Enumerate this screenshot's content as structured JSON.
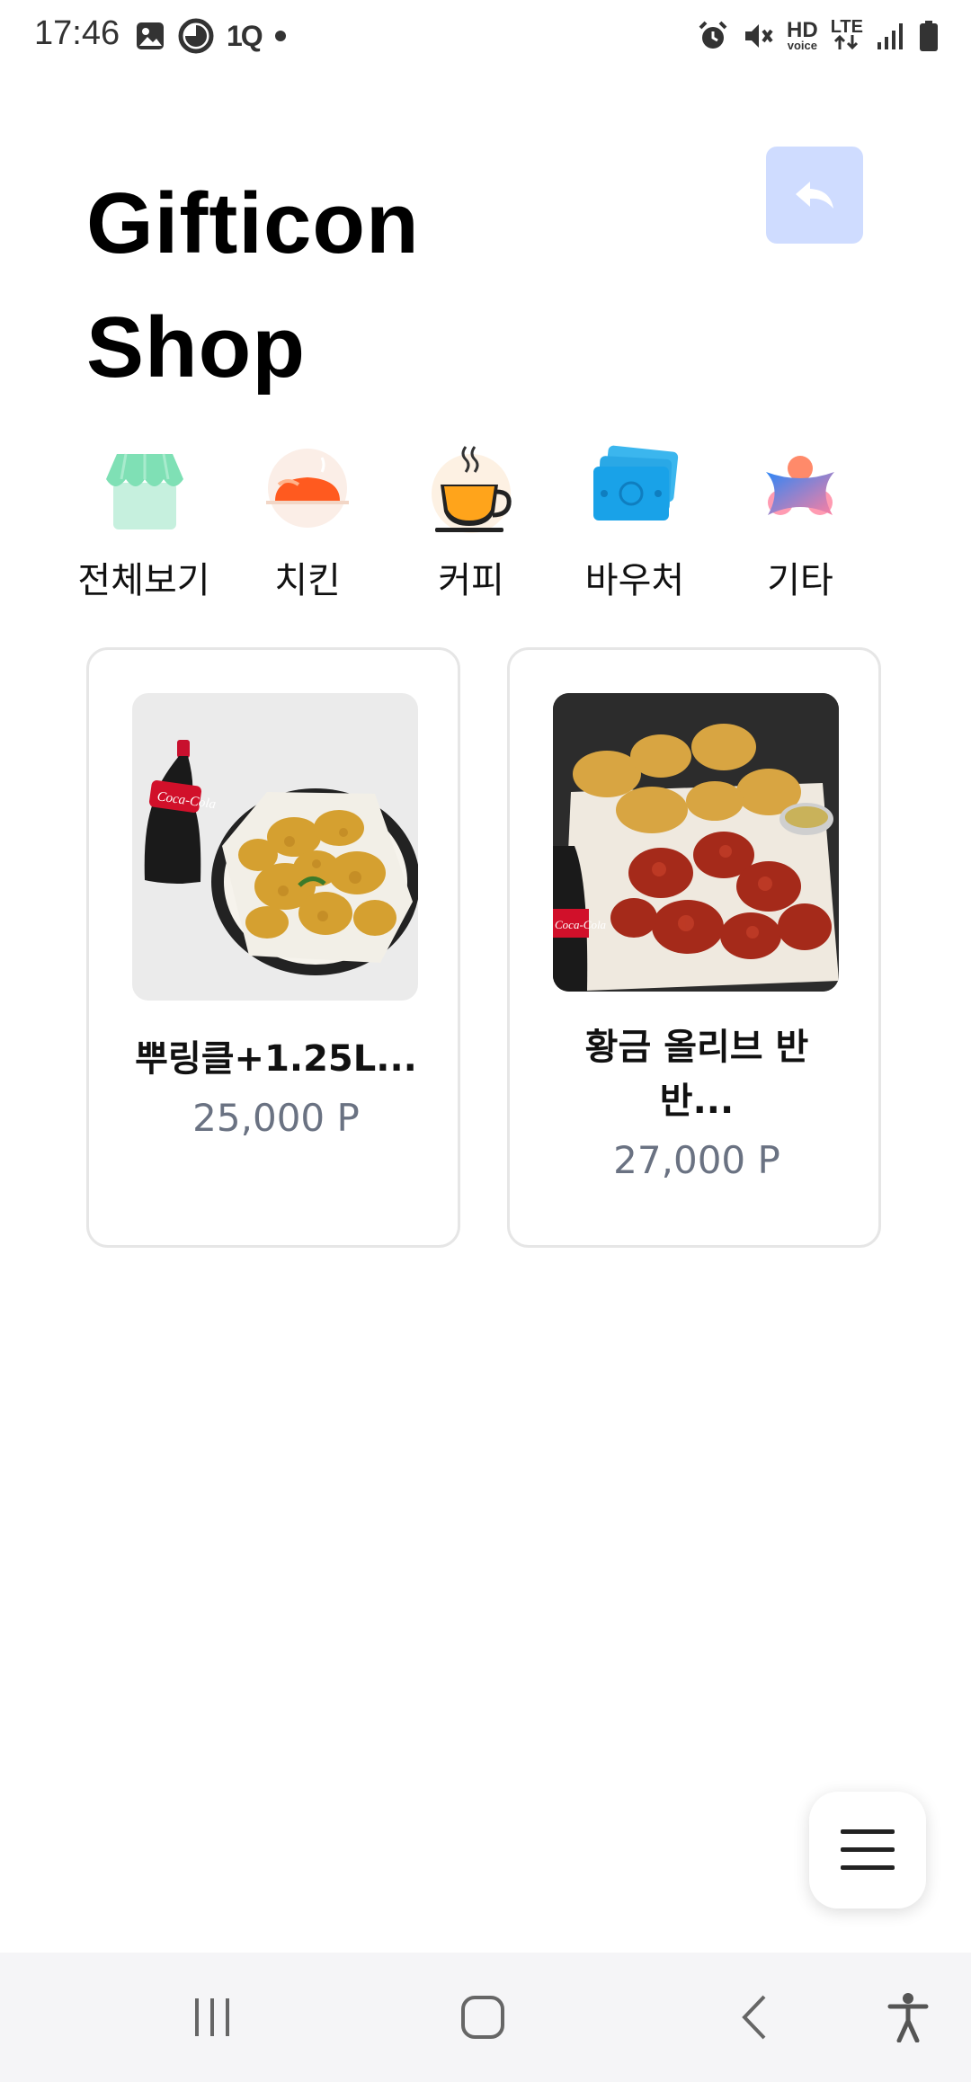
{
  "status_bar": {
    "time": "17:46",
    "left_icons": [
      "image-icon",
      "timer-icon",
      "one-q-icon",
      "dot-icon"
    ],
    "one_q_label": "1Q",
    "right_icons": [
      "alarm-icon",
      "mute-icon",
      "hd-voice-icon",
      "lte-icon",
      "signal-icon",
      "battery-icon"
    ],
    "hd_label": "HD",
    "voice_label": "voice",
    "lte_label": "LTE"
  },
  "header": {
    "title_line1": "Gifticon",
    "title_line2": "Shop",
    "back_icon": "reply-arrow-icon",
    "back_button_color": "#cfdcff"
  },
  "categories": [
    {
      "label": "전체보기",
      "icon": "store-icon"
    },
    {
      "label": "치킨",
      "icon": "chicken-icon"
    },
    {
      "label": "커피",
      "icon": "coffee-icon"
    },
    {
      "label": "바우처",
      "icon": "voucher-icon"
    },
    {
      "label": "기타",
      "icon": "etc-icon"
    }
  ],
  "products": [
    {
      "name": "뿌링클+1.25L...",
      "price": "25,000 P"
    },
    {
      "name_line1": "황금 올리브 반",
      "name_line2": "반...",
      "price": "27,000 P"
    }
  ],
  "fab": {
    "icon": "menu-icon"
  },
  "nav_bar": {
    "buttons": [
      "recent-apps-icon",
      "home-icon",
      "back-icon",
      "accessibility-icon"
    ]
  },
  "colors": {
    "accent": "#cfdcff",
    "price": "#6a7282",
    "background": "#ffffff",
    "card_border": "#e6e6e6"
  }
}
